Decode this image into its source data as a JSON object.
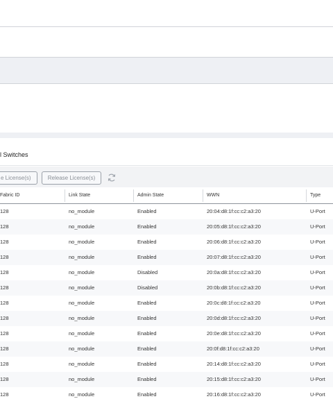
{
  "section": {
    "title": "l Switches"
  },
  "toolbar": {
    "acquire_label": "e License(s)",
    "release_label": "Release License(s)",
    "refresh_icon": "refresh-icon"
  },
  "table": {
    "columns": {
      "fabric_id": "Fabric ID",
      "link_state": "Link State",
      "admin_state": "Admin State",
      "wwn": "WWN",
      "type": "Type"
    },
    "rows": [
      {
        "fabric_id": "128",
        "link_state": "no_module",
        "admin_state": "Enabled",
        "wwn": "20:04:d8:1f:cc:c2:a3:20",
        "type": "U-Port"
      },
      {
        "fabric_id": "128",
        "link_state": "no_module",
        "admin_state": "Enabled",
        "wwn": "20:05:d8:1f:cc:c2:a3:20",
        "type": "U-Port"
      },
      {
        "fabric_id": "128",
        "link_state": "no_module",
        "admin_state": "Enabled",
        "wwn": "20:06:d8:1f:cc:c2:a3:20",
        "type": "U-Port"
      },
      {
        "fabric_id": "128",
        "link_state": "no_module",
        "admin_state": "Enabled",
        "wwn": "20:07:d8:1f:cc:c2:a3:20",
        "type": "U-Port"
      },
      {
        "fabric_id": "128",
        "link_state": "no_module",
        "admin_state": "Disabled",
        "wwn": "20:0a:d8:1f:cc:c2:a3:20",
        "type": "U-Port"
      },
      {
        "fabric_id": "128",
        "link_state": "no_module",
        "admin_state": "Disabled",
        "wwn": "20:0b:d8:1f:cc:c2:a3:20",
        "type": "U-Port"
      },
      {
        "fabric_id": "128",
        "link_state": "no_module",
        "admin_state": "Enabled",
        "wwn": "20:0c:d8:1f:cc:c2:a3:20",
        "type": "U-Port"
      },
      {
        "fabric_id": "128",
        "link_state": "no_module",
        "admin_state": "Enabled",
        "wwn": "20:0d:d8:1f:cc:c2:a3:20",
        "type": "U-Port"
      },
      {
        "fabric_id": "128",
        "link_state": "no_module",
        "admin_state": "Enabled",
        "wwn": "20:0e:d8:1f:cc:c2:a3:20",
        "type": "U-Port"
      },
      {
        "fabric_id": "128",
        "link_state": "no_module",
        "admin_state": "Enabled",
        "wwn": "20:0f:d8:1f:cc:c2:a3:20",
        "type": "U-Port"
      },
      {
        "fabric_id": "128",
        "link_state": "no_module",
        "admin_state": "Enabled",
        "wwn": "20:14:d8:1f:cc:c2:a3:20",
        "type": "U-Port"
      },
      {
        "fabric_id": "128",
        "link_state": "no_module",
        "admin_state": "Enabled",
        "wwn": "20:15:d8:1f:cc:c2:a3:20",
        "type": "U-Port"
      },
      {
        "fabric_id": "128",
        "link_state": "no_module",
        "admin_state": "Enabled",
        "wwn": "20:16:d8:1f:cc:c2:a3:20",
        "type": "U-Port"
      }
    ]
  }
}
